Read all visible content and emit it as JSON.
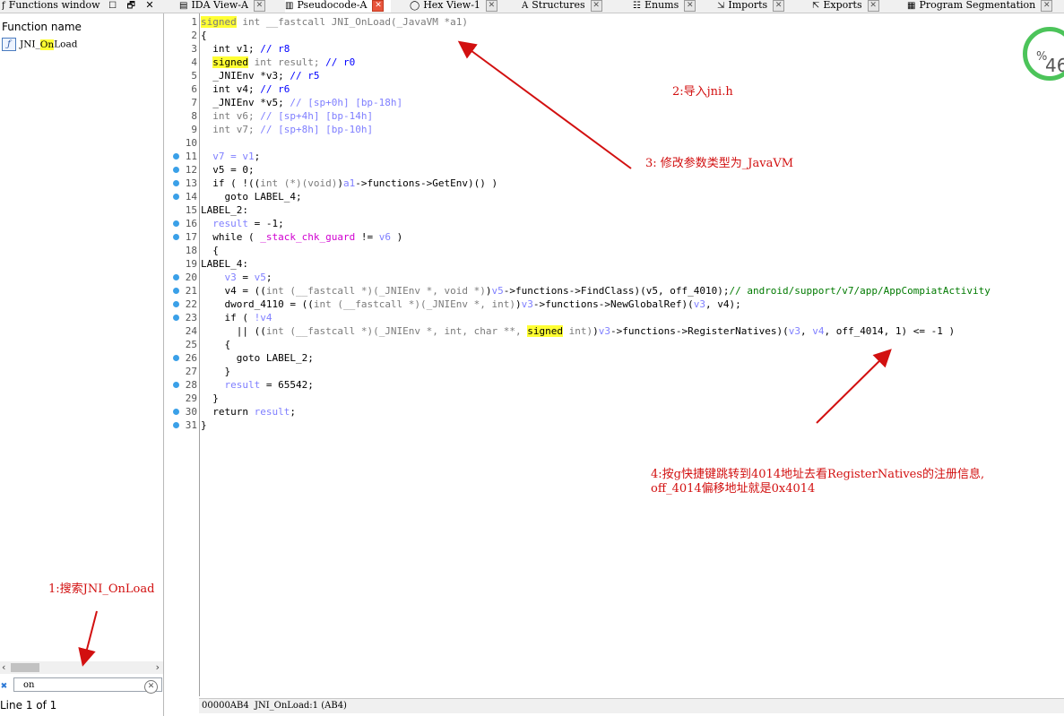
{
  "tabs": [
    {
      "label": "Functions window",
      "icon": "function-icon"
    },
    {
      "label": "IDA View-A",
      "icon": "graph-icon"
    },
    {
      "label": "Pseudocode-A",
      "icon": "pseudocode-icon"
    },
    {
      "label": "Hex View-1",
      "icon": "hex-icon"
    },
    {
      "label": "Structures",
      "icon": "structure-icon"
    },
    {
      "label": "Enums",
      "icon": "enum-icon"
    },
    {
      "label": "Imports",
      "icon": "imports-icon"
    },
    {
      "label": "Exports",
      "icon": "exports-icon"
    },
    {
      "label": "Program Segmentation",
      "icon": "segmentation-icon"
    }
  ],
  "functions_window": {
    "header": "Function name",
    "items": [
      {
        "name_prefix": "JNI_",
        "name_match": "On",
        "name_suffix": "Load"
      }
    ],
    "search_value": "on",
    "status": "Line 1 of 1"
  },
  "code_lines": [
    {
      "n": "1",
      "bp": false
    },
    {
      "n": "2",
      "bp": false
    },
    {
      "n": "3",
      "bp": false
    },
    {
      "n": "4",
      "bp": false
    },
    {
      "n": "5",
      "bp": false
    },
    {
      "n": "6",
      "bp": false
    },
    {
      "n": "7",
      "bp": false
    },
    {
      "n": "8",
      "bp": false
    },
    {
      "n": "9",
      "bp": false
    },
    {
      "n": "10",
      "bp": false
    },
    {
      "n": "11",
      "bp": true
    },
    {
      "n": "12",
      "bp": true
    },
    {
      "n": "13",
      "bp": true
    },
    {
      "n": "14",
      "bp": true
    },
    {
      "n": "15",
      "bp": false
    },
    {
      "n": "16",
      "bp": true
    },
    {
      "n": "17",
      "bp": true
    },
    {
      "n": "18",
      "bp": false
    },
    {
      "n": "19",
      "bp": false
    },
    {
      "n": "20",
      "bp": true
    },
    {
      "n": "21",
      "bp": true
    },
    {
      "n": "22",
      "bp": true
    },
    {
      "n": "23",
      "bp": true
    },
    {
      "n": "24",
      "bp": false
    },
    {
      "n": "25",
      "bp": false
    },
    {
      "n": "26",
      "bp": true
    },
    {
      "n": "27",
      "bp": false
    },
    {
      "n": "28",
      "bp": true
    },
    {
      "n": "29",
      "bp": false
    },
    {
      "n": "30",
      "bp": true
    },
    {
      "n": "31",
      "bp": true
    }
  ],
  "code_text": {
    "l1": [
      "signed",
      " int __fastcall JNI_OnLoad(_JavaVM *a1)"
    ],
    "l2": "{",
    "l3": [
      "  int v1; ",
      "// r8"
    ],
    "l4": [
      "  ",
      "signed",
      " int result; ",
      "// r0"
    ],
    "l5": [
      "  _JNIEnv *v3; ",
      "// r5"
    ],
    "l6": [
      "  int v4; ",
      "// r6"
    ],
    "l7": [
      "  _JNIEnv *v5; ",
      "// [sp+0h] [bp-18h]"
    ],
    "l8": [
      "  int v6; ",
      "// [sp+4h] [bp-14h]"
    ],
    "l9": [
      "  int v7; ",
      "// [sp+8h] [bp-10h]"
    ],
    "l10": "",
    "l11": [
      "  v7 = ",
      "v1",
      ";"
    ],
    "l12": [
      "  v5 = 0;"
    ],
    "l13": [
      "  if ( !((",
      "int (*)(void)",
      ")",
      "a1",
      "->functions->GetEnv)() )"
    ],
    "l14": "    goto LABEL_4;",
    "l15": "LABEL_2:",
    "l16": [
      "  ",
      "result",
      " = -1;"
    ],
    "l17": [
      "  while ( ",
      "_stack_chk_guard",
      " != ",
      "v6",
      " )"
    ],
    "l18": "  {",
    "l19": "LABEL_4:",
    "l20": [
      "    ",
      "v3",
      " = ",
      "v5",
      ";"
    ],
    "l21": [
      "    v4 = ((",
      "int (__fastcall *)(_JNIEnv *, void *)",
      ")",
      "v5",
      "->functions->FindClass)(v5, off_4010);",
      "// android/support/v7/app/AppCompiatActivity"
    ],
    "l22": [
      "    dword_4110 = ((",
      "int (__fastcall *)(_JNIEnv *, int)",
      ")",
      "v3",
      "->functions->NewGlobalRef)(",
      "v3",
      ", v4);"
    ],
    "l23": [
      "    if ( ",
      "!v4"
    ],
    "l24": [
      "      || ((",
      "int (__fastcall *)(_JNIEnv *, int, char **, ",
      "signed",
      " int)",
      ")",
      "v3",
      "->functions->RegisterNatives)(",
      "v3",
      ", ",
      "v4",
      ", off_4014, 1) <= -1 )"
    ],
    "l25": "    {",
    "l26": "      goto LABEL_2;",
    "l27": "    }",
    "l28": [
      "    ",
      "result",
      " = 65542;"
    ],
    "l29": "  }",
    "l30": [
      "  return ",
      "result",
      ";"
    ],
    "l31": "}"
  },
  "status_bar": {
    "address": "00000AB4",
    "location": "JNI_OnLoad:1 (AB4)"
  },
  "progress_badge": {
    "value": "46",
    "unit": "%"
  },
  "annotations": {
    "a1": "1:搜索JNI_OnLoad",
    "a2": "2:导入jni.h",
    "a3": "3: 修改参数类型为_JavaVM",
    "a4_line1": "4:按g快捷键跳转到4014地址去看RegisterNatives的注册信息,",
    "a4_line2": "off_4014偏移地址就是0x4014"
  },
  "colors": {
    "annotation": "#d21010",
    "highlight": "#ffff33",
    "breakpoint": "#3aa0e8",
    "badge_ring": "#4cc45a"
  }
}
